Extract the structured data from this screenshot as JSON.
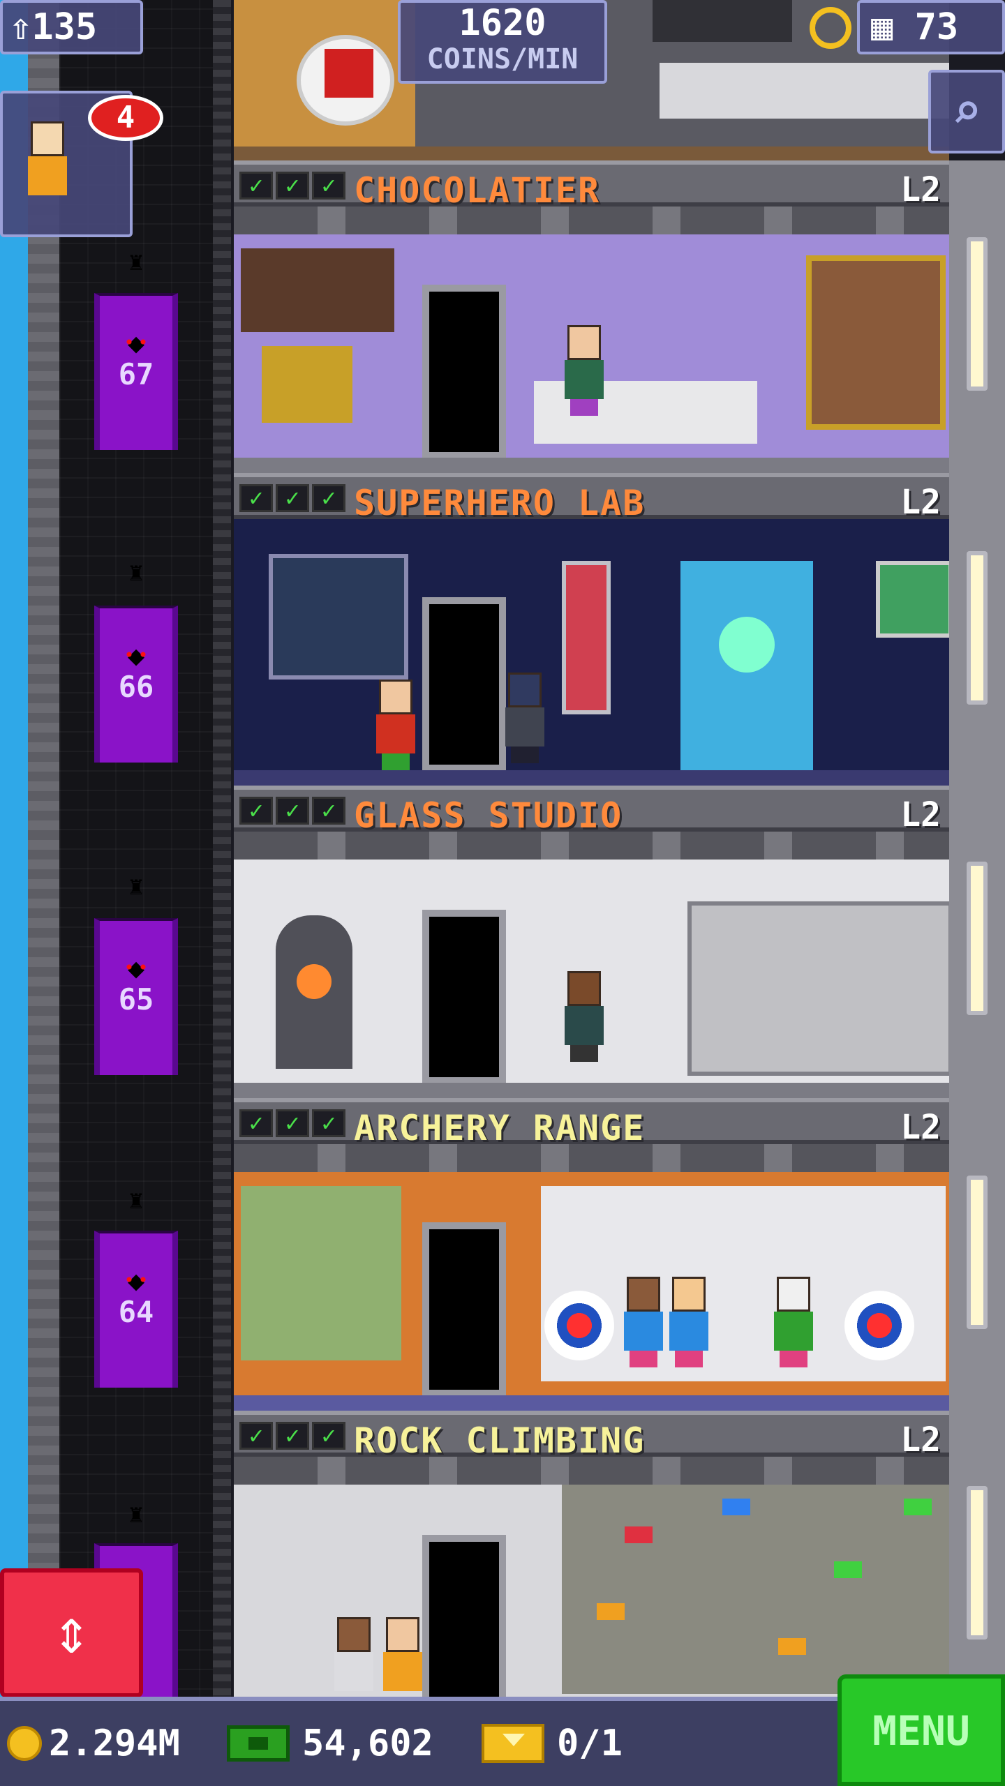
{
  "hud": {
    "population": "135",
    "coins_per_min_value": "1620",
    "coins_per_min_label": "COINS/MIN",
    "floor_count": "73",
    "notification_count": "4"
  },
  "elevator": {
    "floor_numbers": [
      "67",
      "66",
      "65",
      "64"
    ]
  },
  "floors": [
    {
      "name": "CHOCOLATIER",
      "level": "L2",
      "checks": [
        "✓",
        "✓",
        "✓"
      ]
    },
    {
      "name": "SUPERHERO LAB",
      "level": "L2",
      "checks": [
        "✓",
        "✓",
        "✓"
      ]
    },
    {
      "name": "GLASS STUDIO",
      "level": "L2",
      "checks": [
        "✓",
        "✓",
        "✓"
      ]
    },
    {
      "name": "ARCHERY RANGE",
      "level": "L2",
      "checks": [
        "✓",
        "✓",
        "✓"
      ]
    },
    {
      "name": "ROCK CLIMBING",
      "level": "L2",
      "checks": [
        "✓",
        "✓",
        "✓"
      ]
    }
  ],
  "bottom_bar": {
    "coins": "2.294M",
    "bux": "54,602",
    "tickets": "0/1",
    "menu_label": "MENU"
  },
  "icons": {
    "population": "person-up-icon",
    "floors": "building-icon",
    "search": "magnifier-icon",
    "elevator": "up-down-arrows-icon",
    "coins": "coin-icon",
    "bux": "bux-icon",
    "tickets": "ticket-icon"
  },
  "colors": {
    "shaft_purple": "#8a13c8",
    "menu_green": "#28c828",
    "elevator_button_red": "#f0304a",
    "hud_bg": "#464878",
    "floor_name_orange": "#ff8a3c",
    "floor_name_yellow": "#f7f29a"
  }
}
